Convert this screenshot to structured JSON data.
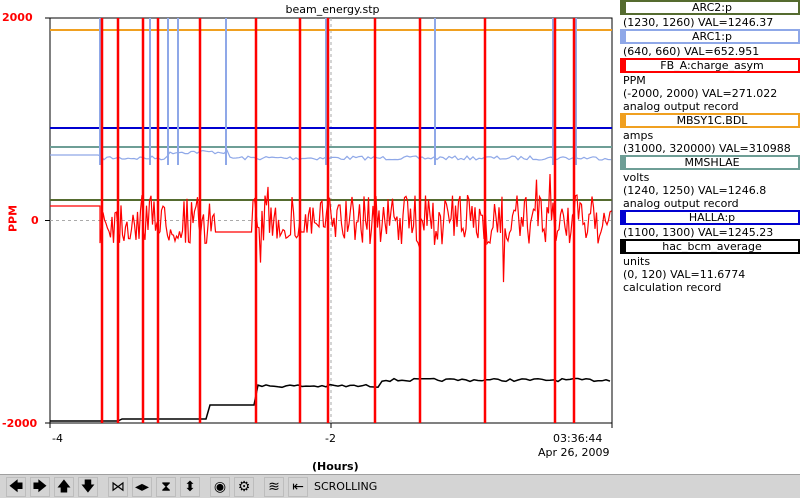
{
  "title": "beam_energy.stp",
  "chart_data": {
    "type": "line",
    "title": "beam_energy.stp",
    "xlabel": "(Hours)",
    "ylabel": "PPM",
    "xlim": [
      -4,
      0
    ],
    "ylim": [
      -2000,
      2000
    ],
    "y_ticks": [
      "2000",
      "0",
      "-2000"
    ],
    "x_ticks": [
      "-4",
      "-2",
      "03:36:44"
    ],
    "x_date": "Apr 26, 2009",
    "grid": true,
    "series": [
      {
        "name": "ARC2:p",
        "color": "#556b2f"
      },
      {
        "name": "ARC1:p",
        "color": "#8fa8e8"
      },
      {
        "name": "FB_A:charge_asym",
        "color": "#ff0000"
      },
      {
        "name": "MBSY1C.BDL",
        "color": "#f0a020"
      },
      {
        "name": "MMSHLAE",
        "color": "#6e9e96"
      },
      {
        "name": "HALLA:p",
        "color": "#0000d0"
      },
      {
        "name": "hac_bcm_average",
        "color": "#000000"
      }
    ]
  },
  "legend": [
    {
      "name": "ARC2:p",
      "color": "#556b2f",
      "lines": [
        "(1230, 1260) VAL=1246.37"
      ]
    },
    {
      "name": "ARC1:p",
      "color": "#8fa8e8",
      "lines": [
        "(640, 660) VAL=652.951"
      ]
    },
    {
      "name": "FB_A:charge_asym",
      "color": "#ff0000",
      "lines": [
        "PPM",
        "(-2000, 2000) VAL=271.022",
        "analog output record"
      ]
    },
    {
      "name": "MBSY1C.BDL",
      "color": "#f0a020",
      "lines": [
        "amps",
        "(31000, 320000) VAL=310988"
      ]
    },
    {
      "name": "MMSHLAE",
      "color": "#6e9e96",
      "lines": [
        "volts",
        "(1240, 1250)  VAL=1246.8",
        "analog output record"
      ]
    },
    {
      "name": "HALLA:p",
      "color": "#0000d0",
      "lines": [
        "(1100, 1300) VAL=1245.23"
      ]
    },
    {
      "name": "hac_bcm_average",
      "color": "#000000",
      "lines": [
        "units",
        "(0, 120) VAL=11.6774",
        "calculation record"
      ]
    }
  ],
  "toolbar": {
    "buttons": [
      {
        "name": "pan-left-icon",
        "glyph": "🡄"
      },
      {
        "name": "pan-right-icon",
        "glyph": "🡆"
      },
      {
        "name": "pan-up-icon",
        "glyph": "🡅"
      },
      {
        "name": "pan-down-icon",
        "glyph": "🡇"
      },
      {
        "name": "zoom-in-x-icon",
        "glyph": "⋈"
      },
      {
        "name": "zoom-out-x-icon",
        "glyph": "◂▸"
      },
      {
        "name": "zoom-in-y-icon",
        "glyph": "⧗"
      },
      {
        "name": "zoom-out-y-icon",
        "glyph": "⬍"
      },
      {
        "name": "autoscale-icon",
        "glyph": "◉"
      },
      {
        "name": "config-icon",
        "glyph": "⚙"
      },
      {
        "name": "stagger-icon",
        "glyph": "≋"
      },
      {
        "name": "scroll-mode-icon",
        "glyph": "⇤"
      }
    ],
    "status": "SCROLLING"
  }
}
